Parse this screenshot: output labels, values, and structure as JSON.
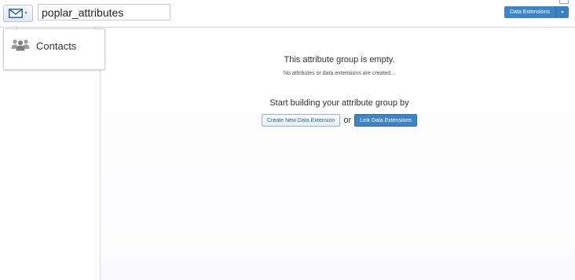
{
  "toolbar": {
    "mail_button_icon": "envelope-icon",
    "attribute_group_name": "poplar_attributes",
    "data_extensions_button_label": "Data Extensions",
    "data_extensions_caret": "▾",
    "mail_caret": "▾"
  },
  "left_panel": {
    "contacts_card": {
      "icon": "people-group-icon",
      "label": "Contacts"
    }
  },
  "empty_state": {
    "title": "This attribute group is empty.",
    "subtitle": "No attributes or data extensions are created...",
    "start_text": "Start building your attribute group by",
    "create_button_label": "Create New Data Extension",
    "or_text": "or",
    "link_button_label": "Link Data Extensions"
  },
  "colors": {
    "accent_blue": "#3d84c6",
    "border_gray": "#d4d4d4"
  }
}
